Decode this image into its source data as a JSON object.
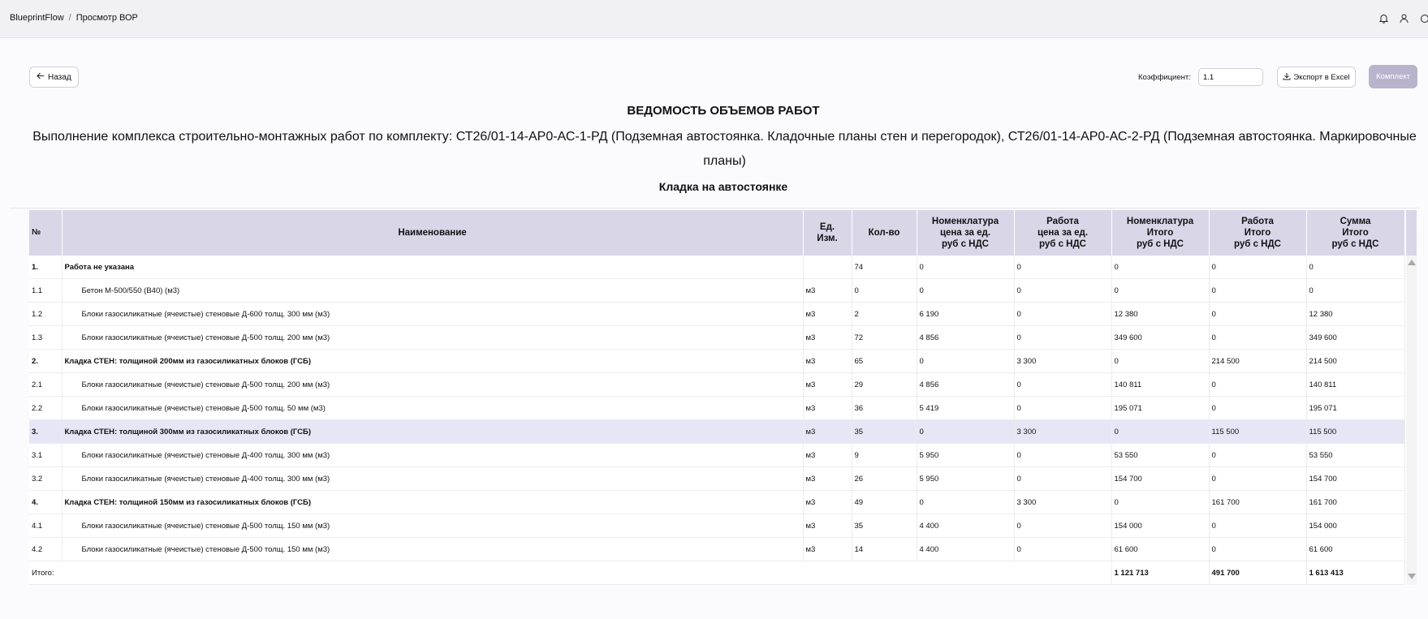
{
  "breadcrumb": {
    "app": "BlueprintFlow",
    "separator": "/",
    "page": "Просмотр ВОР"
  },
  "toolbar": {
    "back_label": "Назад",
    "coef_label": "Коэффициент:",
    "coef_value": "1.1",
    "export_label": "Экспорт в Excel",
    "kit_label": "Комплект"
  },
  "document": {
    "title": "ВЕДОМОСТЬ ОБЪЕМОВ РАБОТ",
    "description": "Выполнение комплекса строительно-монтажных работ по комплекту: СТ26/01-14-АР0-АС-1-РД (Подземная автостоянка. Кладочные планы стен и перегородок), СТ26/01-14-АР0-АС-2-РД (Подземная автостоянка. Маркировочные планы)",
    "section": "Кладка на автостоянке"
  },
  "table": {
    "headers": {
      "num": "№",
      "name": "Наименование",
      "unit_1": "Ед.",
      "unit_2": "Изм.",
      "qty": "Кол-во",
      "nom_price_1": "Номенклатура",
      "nom_price_2": "цена за ед.",
      "nom_price_3": "руб с НДС",
      "work_price_1": "Работа",
      "work_price_2": "цена за ед.",
      "work_price_3": "руб с НДС",
      "nom_total_1": "Номенклатура",
      "nom_total_2": "Итого",
      "nom_total_3": "руб с НДС",
      "work_total_1": "Работа",
      "work_total_2": "Итого",
      "work_total_3": "руб с НДС",
      "sum_1": "Сумма",
      "sum_2": "Итого",
      "sum_3": "руб с НДС"
    },
    "rows": [
      {
        "num": "1.",
        "name": "Работа не указана",
        "unit": "",
        "qty": "74",
        "nom_price": "0",
        "work_price": "0",
        "nom_total": "0",
        "work_total": "0",
        "sum": "0"
      },
      {
        "num": "1.1",
        "name": "Бетон М-500/550 (В40) (м3)",
        "unit": "м3",
        "qty": "0",
        "nom_price": "0",
        "work_price": "0",
        "nom_total": "0",
        "work_total": "0",
        "sum": "0"
      },
      {
        "num": "1.2",
        "name": "Блоки газосиликатные (ячеистые) стеновые Д-600 толщ. 300 мм (м3)",
        "unit": "м3",
        "qty": "2",
        "nom_price": "6 190",
        "work_price": "0",
        "nom_total": "12 380",
        "work_total": "0",
        "sum": "12 380"
      },
      {
        "num": "1.3",
        "name": "Блоки газосиликатные (ячеистые) стеновые Д-500 толщ. 200 мм (м3)",
        "unit": "м3",
        "qty": "72",
        "nom_price": "4 856",
        "work_price": "0",
        "nom_total": "349 600",
        "work_total": "0",
        "sum": "349 600"
      },
      {
        "num": "2.",
        "name": "Кладка СТЕН: толщиной 200мм из газосиликатных  блоков (ГСБ)",
        "unit": "м3",
        "qty": "65",
        "nom_price": "0",
        "work_price": "3 300",
        "nom_total": "0",
        "work_total": "214 500",
        "sum": "214 500"
      },
      {
        "num": "2.1",
        "name": "Блоки газосиликатные (ячеистые) стеновые Д-500 толщ. 200 мм (м3)",
        "unit": "м3",
        "qty": "29",
        "nom_price": "4 856",
        "work_price": "0",
        "nom_total": "140 811",
        "work_total": "0",
        "sum": "140 811"
      },
      {
        "num": "2.2",
        "name": "Блоки газосиликатные (ячеистые) стеновые Д-500 толщ. 50 мм (м3)",
        "unit": "м3",
        "qty": "36",
        "nom_price": "5 419",
        "work_price": "0",
        "nom_total": "195 071",
        "work_total": "0",
        "sum": "195 071"
      },
      {
        "num": "3.",
        "name": "Кладка СТЕН: толщиной 300мм из газосиликатных  блоков (ГСБ)",
        "unit": "м3",
        "qty": "35",
        "nom_price": "0",
        "work_price": "3 300",
        "nom_total": "0",
        "work_total": "115 500",
        "sum": "115 500"
      },
      {
        "num": "3.1",
        "name": "Блоки газосиликатные (ячеистые) стеновые Д-400 толщ. 300 мм (м3)",
        "unit": "м3",
        "qty": "9",
        "nom_price": "5 950",
        "work_price": "0",
        "nom_total": "53 550",
        "work_total": "0",
        "sum": "53 550"
      },
      {
        "num": "3.2",
        "name": "Блоки газосиликатные (ячеистые) стеновые Д-400 толщ. 300 мм (м3)",
        "unit": "м3",
        "qty": "26",
        "nom_price": "5 950",
        "work_price": "0",
        "nom_total": "154 700",
        "work_total": "0",
        "sum": "154 700"
      },
      {
        "num": "4.",
        "name": "Кладка СТЕН: толщиной 150мм из газосиликатных  блоков (ГСБ)",
        "unit": "м3",
        "qty": "49",
        "nom_price": "0",
        "work_price": "3 300",
        "nom_total": "0",
        "work_total": "161 700",
        "sum": "161 700"
      },
      {
        "num": "4.1",
        "name": "Блоки газосиликатные (ячеистые) стеновые Д-500 толщ. 150 мм (м3)",
        "unit": "м3",
        "qty": "35",
        "nom_price": "4 400",
        "work_price": "0",
        "nom_total": "154 000",
        "work_total": "0",
        "sum": "154 000"
      },
      {
        "num": "4.2",
        "name": "Блоки газосиликатные (ячеистые) стеновые Д-500 толщ. 150 мм (м3)",
        "unit": "м3",
        "qty": "14",
        "nom_price": "4 400",
        "work_price": "0",
        "nom_total": "61 600",
        "work_total": "0",
        "sum": "61 600"
      }
    ],
    "total": {
      "label": "Итого:",
      "nom_total": "1 121 713",
      "work_total": "491 700",
      "sum": "1 613 413"
    }
  },
  "colors": {
    "header_bg": "#d9d6e8",
    "highlight_row": "#e7e6f6",
    "kit_button": "#b9b4cc"
  },
  "icons": {
    "back": "arrow-left-icon",
    "export": "download-icon",
    "bell": "bell-icon",
    "user": "user-icon",
    "search": "search-icon"
  }
}
